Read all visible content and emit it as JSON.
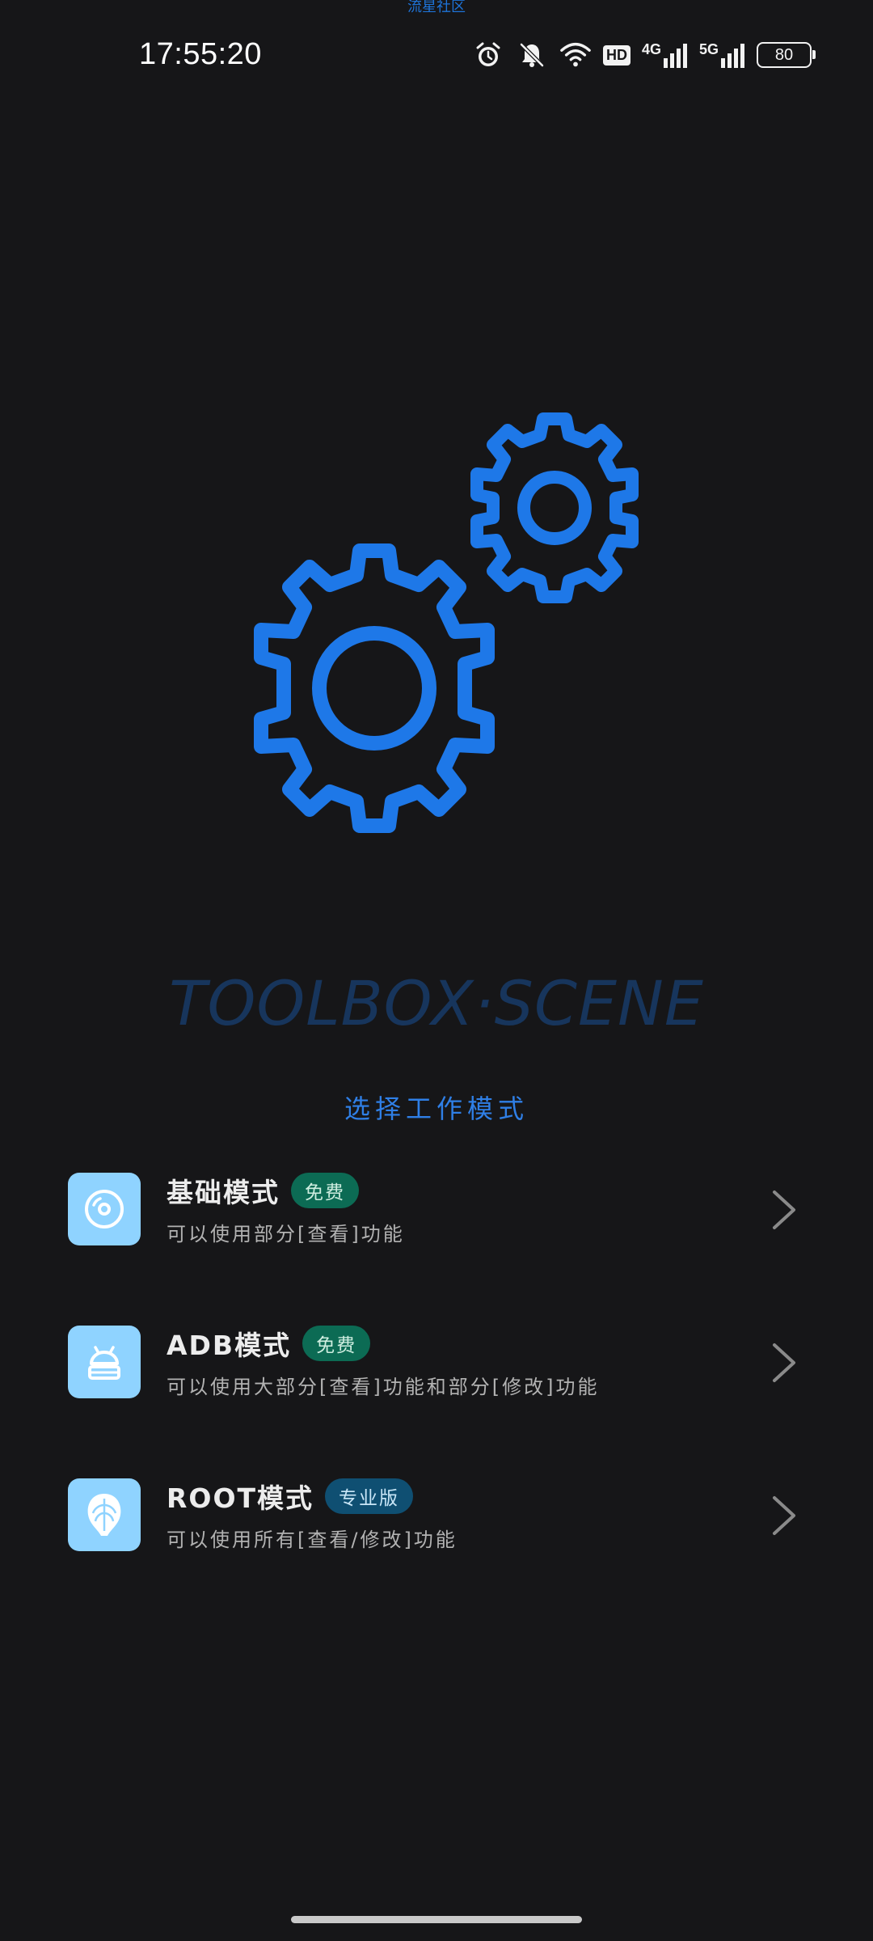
{
  "top_label": "流星社区",
  "status_bar": {
    "time": "17:55:20",
    "battery": "80",
    "hd_label": "HD",
    "net_4g": "4G",
    "net_5g": "5G",
    "icons": [
      "alarm-icon",
      "mute-bell-icon",
      "wifi-icon",
      "hd-icon",
      "signal-4g-icon",
      "signal-5g-icon",
      "battery-icon"
    ]
  },
  "hero": {
    "illustration": "gears-icon",
    "accent": "#1e78e8",
    "title": "TOOLBOX·SCENE",
    "subtitle": "选择工作模式"
  },
  "modes": [
    {
      "title": "基础模式",
      "badge": "免费",
      "badge_type": "free",
      "description": "可以使用部分[查看]功能",
      "icon": "disc-icon"
    },
    {
      "title": "ADB模式",
      "badge": "免费",
      "badge_type": "free",
      "description": "可以使用大部分[查看]功能和部分[修改]功能",
      "icon": "android-icon"
    },
    {
      "title": "ROOT模式",
      "badge": "专业版",
      "badge_type": "pro",
      "description": "可以使用所有[查看/修改]功能",
      "icon": "root-shell-icon"
    }
  ]
}
